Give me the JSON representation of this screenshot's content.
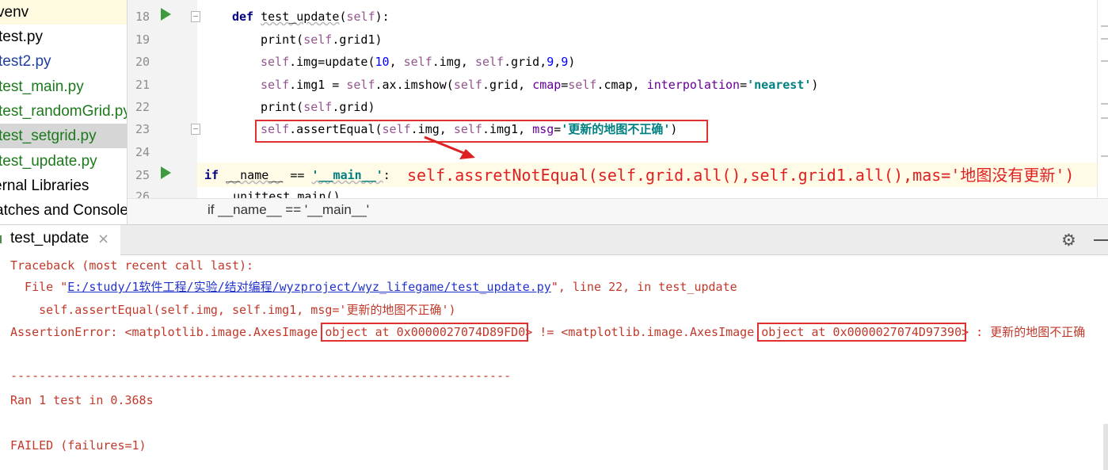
{
  "project_tree": {
    "items": [
      {
        "label": "venv"
      },
      {
        "label": "test.py"
      },
      {
        "label": "test2.py"
      },
      {
        "label": "test_main.py"
      },
      {
        "label": "test_randomGrid.py"
      },
      {
        "label": "test_setgrid.py"
      },
      {
        "label": "test_update.py"
      },
      {
        "label": "ernal Libraries"
      },
      {
        "label": "atches and Consoles"
      }
    ]
  },
  "editor": {
    "line_numbers": [
      "18",
      "19",
      "20",
      "21",
      "22",
      "23",
      "24",
      "25",
      "26"
    ],
    "lines": {
      "l18": {
        "def": "def",
        "name": "test_update",
        "p1": "(",
        "self": "self",
        "p2": "):"
      },
      "l19": {
        "a": "print(",
        "self": "self",
        "b": ".grid1)"
      },
      "l20": {
        "self1": "self",
        "a": ".img=update(",
        "n10": "10",
        "c1": ", ",
        "self2": "self",
        "b": ".img, ",
        "self3": "self",
        "c": ".grid,",
        "n9a": "9",
        "c2": ",",
        "n9b": "9",
        "d": ")"
      },
      "l21": {
        "self1": "self",
        "a": ".img1 = ",
        "self2": "self",
        "b": ".ax.imshow(",
        "self3": "self",
        "c": ".grid, ",
        "cmap": "cmap",
        "eq1": "=",
        "self4": "self",
        "d": ".cmap, ",
        "interp": "interpolation",
        "eq2": "=",
        "str": "'nearest'",
        "e": ")"
      },
      "l22": {
        "a": "print(",
        "self": "self",
        "b": ".grid)"
      },
      "l23": {
        "self1": "self",
        "a": ".assertEqual(",
        "self2": "self",
        "b": ".img, ",
        "self3": "self",
        "c": ".img1, ",
        "msg": "msg",
        "eq": "=",
        "str": "'更新的地图不正确'",
        "d": ")"
      },
      "l25": {
        "if": "if",
        "a": " ",
        "name": "__name__",
        "b": " == ",
        "str": "'__main__'",
        "c": ":"
      },
      "l26": {
        "a": "    unittest.main()"
      }
    },
    "annotation": "self.assretNotEqual(self.grid.all(),self.grid1.all(),mas='地图没有更新')",
    "breadcrumb": "if __name__ == '__main__'"
  },
  "run_panel": {
    "tab_label": "test_update",
    "close_glyph": "×",
    "gear_glyph": "⚙",
    "output": {
      "traceback": "Traceback (most recent call last):",
      "file_prefix": "  File \"",
      "file_path": "E:/study/1软件工程/实验/结对编程/wyzproject/wyz_lifegame/test_update.py",
      "file_suffix": "\", line 22, in test_update",
      "code_line": "    self.assertEqual(self.img, self.img1, msg='更新的地图不正确')",
      "error_a": "AssertionError: <matplotlib.image.AxesImage ",
      "error_obj1": "object at 0x0000027074D89FD0>",
      "error_b": " != <matplotlib.image.AxesImage ",
      "error_obj2": "object at 0x0000027074D97390>",
      "error_c": " : 更新的地图不正确",
      "separator": "----------------------------------------------------------------------",
      "ran": "Ran 1 test in 0.368s",
      "failed": "FAILED (failures=1)"
    }
  },
  "colors": {
    "keyword": "#000080",
    "self": "#94558d",
    "string": "#008080",
    "number": "#0000ff",
    "error_text": "#c0392b",
    "highlight_box": "#e03030"
  }
}
